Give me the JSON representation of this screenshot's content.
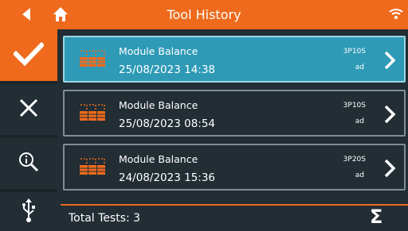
{
  "header": {
    "title": "Tool History",
    "back_icon": "back-arrow-icon",
    "home_icon": "home-icon",
    "wifi_icon": "wifi-icon"
  },
  "sidebar": {
    "items": [
      {
        "icon": "checkmark-icon",
        "active": true
      },
      {
        "icon": "close-icon"
      },
      {
        "icon": "magnifier-icon"
      },
      {
        "icon": "usb-icon"
      }
    ]
  },
  "records": [
    {
      "name": "Module Balance",
      "date": "25/08/2023 14:38",
      "config": "3P10S",
      "user": "ad",
      "selected": true
    },
    {
      "name": "Module Balance",
      "date": "25/08/2023 08:54",
      "config": "3P10S",
      "user": "ad",
      "selected": false
    },
    {
      "name": "Module Balance",
      "date": "24/08/2023 15:36",
      "config": "3P20S",
      "user": "ad",
      "selected": false
    }
  ],
  "footer": {
    "total_label": "Total Tests: 3",
    "sigma": "Σ"
  },
  "colors": {
    "accent": "#ef6a1c",
    "background": "#222d34",
    "selected": "#2e9ab6",
    "border": "#7f8e97"
  }
}
